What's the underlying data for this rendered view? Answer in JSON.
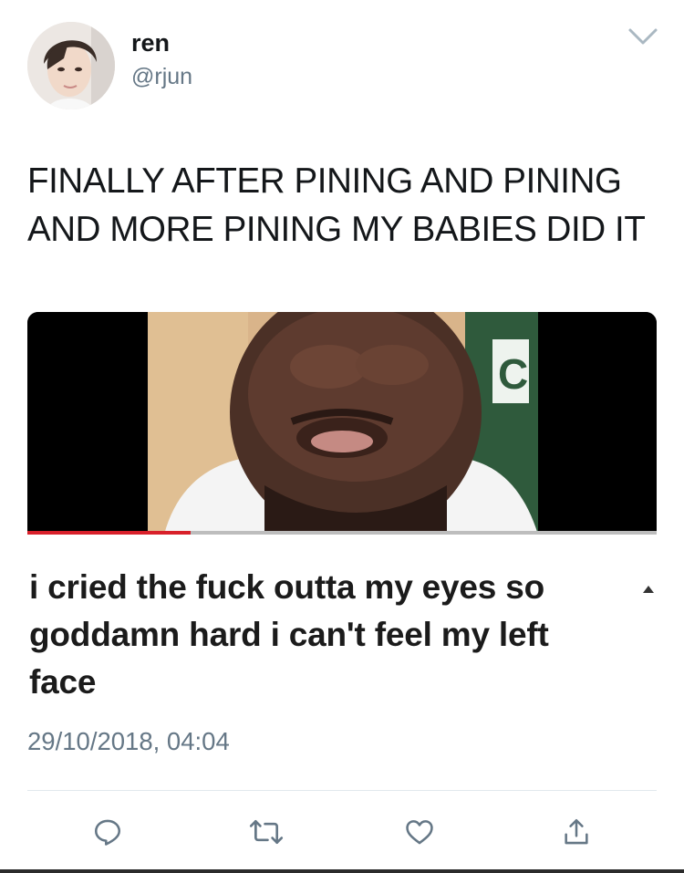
{
  "user": {
    "display_name": "ren",
    "handle": "@rjun",
    "avatar_icon": "avatar-photo"
  },
  "tweet": {
    "text": "FINALLY AFTER PINING AND PINING AND MORE PINING MY BABIES DID IT",
    "timestamp": "29/10/2018, 04:04"
  },
  "media": {
    "caption": "i cried the fuck outta my eyes so goddamn hard i can't feel my left face",
    "progress_fraction": 0.26
  },
  "actions": {
    "reply_icon": "reply-icon",
    "retweet_icon": "retweet-icon",
    "like_icon": "heart-icon",
    "share_icon": "share-icon"
  },
  "colors": {
    "primary_text": "#14171a",
    "secondary_text": "#657786",
    "divider": "#e1e8ed",
    "video_progress": "#d8202a"
  }
}
